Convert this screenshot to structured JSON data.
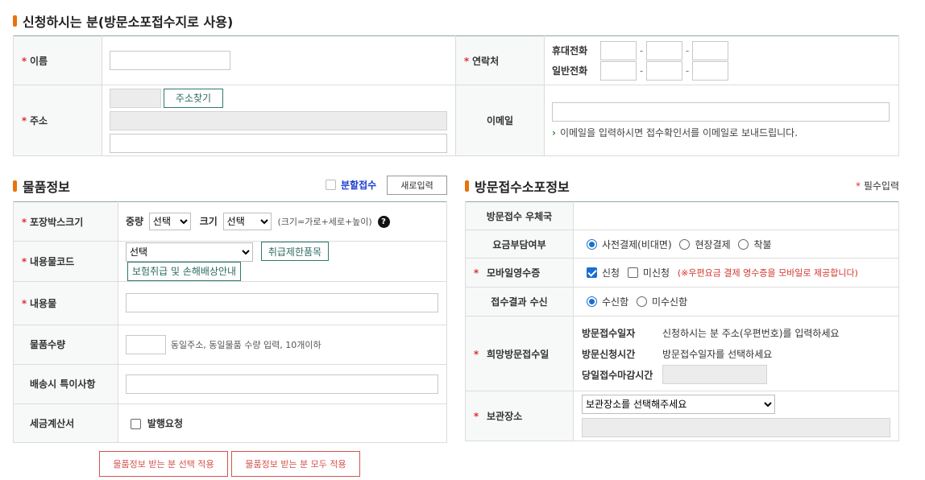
{
  "applicant": {
    "title": "신청하시는 분(방문소포접수지로 사용)",
    "name_label": "이름",
    "contact_label": "연락처",
    "mobile_label": "휴대전화",
    "phone_label": "일반전화",
    "address_label": "주소",
    "find_address_label": "주소찾기",
    "email_label": "이메일",
    "email_note": "이메일을 입력하시면 접수확인서를 이메일로 보내드립니다."
  },
  "goods": {
    "title": "물품정보",
    "split_label": "분할접수",
    "new_input_label": "새로입력",
    "box_size_label": "포장박스크기",
    "weight_label": "중량",
    "weight_value": "선택",
    "size_label": "크기",
    "size_value": "선택",
    "size_hint": "(크기=가로+세로+높이)",
    "code_label": "내용물코드",
    "code_value": "선택",
    "restricted_label": "취급제한품목",
    "insurance_label": "보험취급 및 손해배상안내",
    "content_label": "내용물",
    "qty_label": "물품수량",
    "qty_note": "동일주소, 동일물품 수량 입력, 10개이하",
    "special_label": "배송시 특이사항",
    "invoice_label": "세금계산서",
    "invoice_option": "발행요청",
    "apply_selected_label": "물품정보 받는 분 선택 적용",
    "apply_all_label": "물품정보 받는 분 모두 적용"
  },
  "visit": {
    "title": "방문접수소포정보",
    "required_note": "필수입력",
    "office_label": "방문접수 우체국",
    "payment_label": "요금부담여부",
    "payment_options": [
      "사전결제(비대면)",
      "현장결제",
      "착불"
    ],
    "receipt_label": "모바일영수증",
    "receipt_yes": "신청",
    "receipt_no": "미신청",
    "receipt_note": "(※우편요금 결제 영수증을 모바일로 제공합니다)",
    "result_label": "접수결과 수신",
    "result_yes": "수신함",
    "result_no": "미수신함",
    "hope_label": "희망방문접수일",
    "visit_date_label": "방문접수일자",
    "visit_date_value": "신청하시는 분 주소(우편번호)를 입력하세요",
    "visit_time_label": "방문신청시간",
    "visit_time_value": "방문접수일자를 선택하세요",
    "deadline_label": "당일접수마감시간",
    "storage_label": "보관장소",
    "storage_value": "보관장소를 선택해주세요"
  },
  "colors": {
    "accent": "#e8720c",
    "required": "#e0322e",
    "button_green": "#2e7a6c",
    "button_red": "#d4534b",
    "link_blue": "#1a3cd1"
  }
}
